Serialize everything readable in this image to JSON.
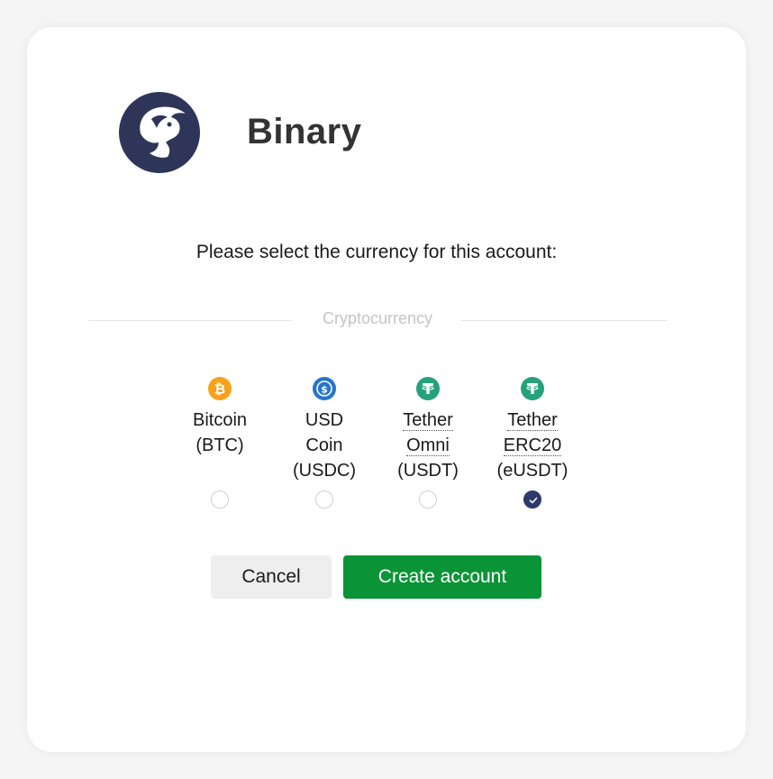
{
  "brand": {
    "name": "Binary",
    "logo_icon": "bull-logo-icon",
    "logo_color": "#2e3559"
  },
  "prompt": "Please select the currency for this account:",
  "section_label": "Cryptocurrency",
  "currencies": [
    {
      "icon": "bitcoin-icon",
      "color": "#f7a21b",
      "lines": [
        "Bitcoin",
        "(BTC)"
      ],
      "selected": false
    },
    {
      "icon": "usd-coin-icon",
      "color": "#2775ca",
      "lines": [
        "USD",
        "Coin",
        "(USDC)"
      ],
      "selected": false
    },
    {
      "icon": "tether-icon",
      "color": "#26a17b",
      "lines": [
        "Tether",
        "Omni",
        "(USDT)"
      ],
      "selected": false
    },
    {
      "icon": "tether-icon",
      "color": "#26a17b",
      "lines": [
        "Tether",
        "ERC20",
        "(eUSDT)"
      ],
      "selected": true
    }
  ],
  "buttons": {
    "cancel": "Cancel",
    "create": "Create account",
    "create_color": "#0b9437"
  }
}
